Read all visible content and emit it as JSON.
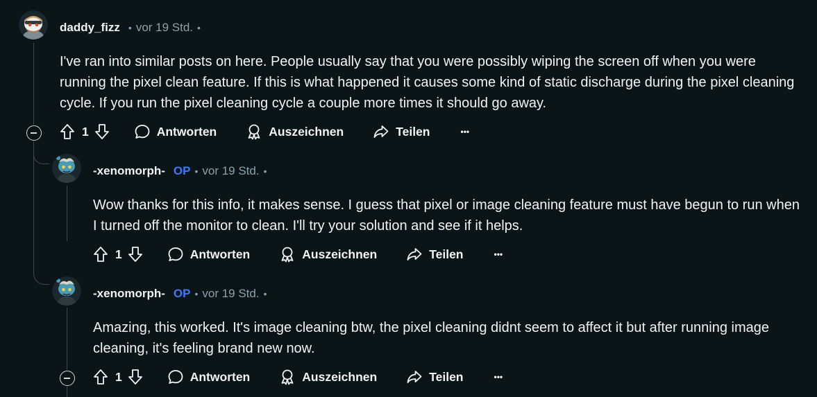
{
  "comments": [
    {
      "author": "daddy_fizz",
      "op": "",
      "time": "vor 19 Std.",
      "text": "I've ran into similar posts on here. People usually say that you were possibly wiping the screen off when you were running the pixel clean feature. If this is what happened it causes some kind of static discharge during the pixel cleaning cycle. If you run the pixel cleaning cycle a couple more times it should go away.",
      "score": "1",
      "avatar_icon": "snoo-avatar-icon"
    },
    {
      "author": "-xenomorph-",
      "op": "OP",
      "time": "vor 19 Std.",
      "text": "Wow thanks for this info, it makes sense. I guess that pixel or image cleaning feature must have begun to run when I turned off the monitor to clean. I'll try your solution and see if it helps.",
      "score": "1",
      "avatar_icon": "snoo-avatar-icon"
    },
    {
      "author": "-xenomorph-",
      "op": "OP",
      "time": "vor 19 Std.",
      "text": "Amazing, this worked. It's image cleaning btw, the pixel cleaning didnt seem to affect it but after running image cleaning, it's feeling brand new now.",
      "score": "1",
      "avatar_icon": "snoo-avatar-icon"
    }
  ],
  "actions": {
    "reply": "Antworten",
    "award": "Auszeichnen",
    "share": "Teilen",
    "more": "•••"
  },
  "icons": [
    "upvote-icon",
    "downvote-icon",
    "comment-bubble-icon",
    "award-icon",
    "share-icon",
    "more-icon",
    "collapse-icon"
  ],
  "colors": {
    "background": "#0b1416",
    "text": "#f2f4f5",
    "meta": "#8ba2ad",
    "op": "#3f78ff",
    "thread_line": "#3e4a4f"
  }
}
